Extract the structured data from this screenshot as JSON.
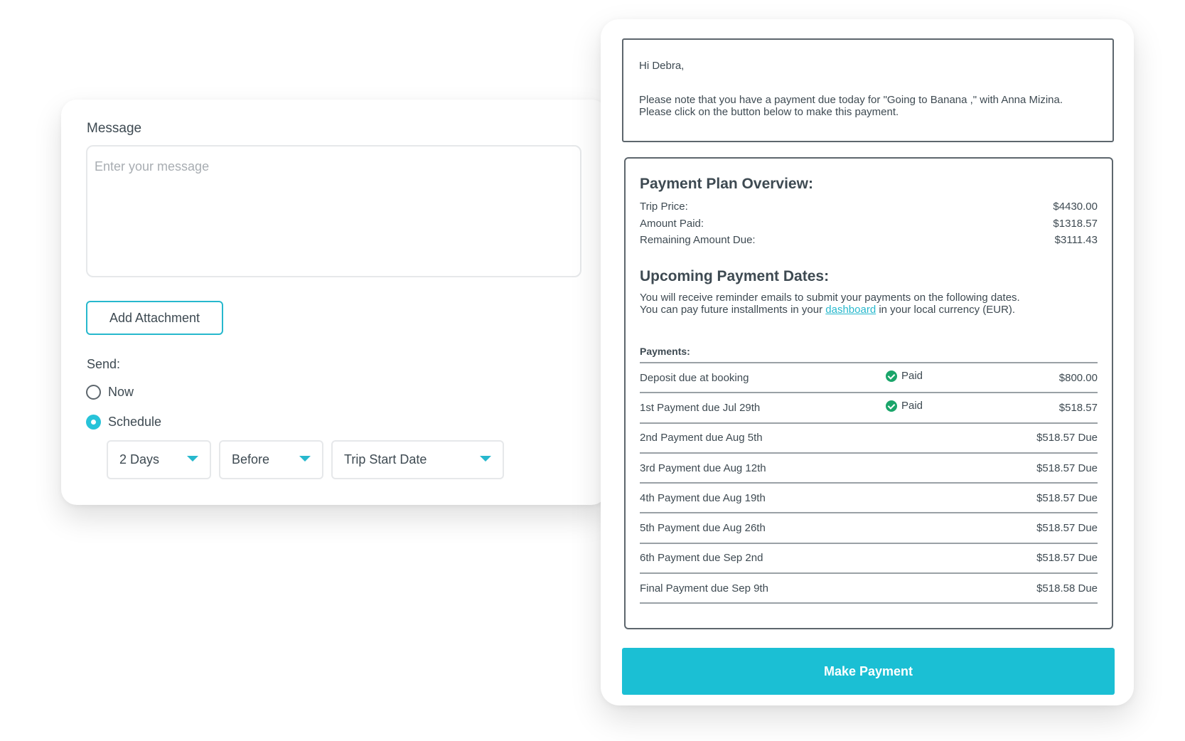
{
  "composer": {
    "message_label": "Message",
    "message_placeholder": "Enter your message",
    "add_attachment_label": "Add Attachment",
    "send_label": "Send:",
    "send_options": [
      {
        "label": "Now",
        "selected": false
      },
      {
        "label": "Schedule",
        "selected": true
      }
    ],
    "schedule": {
      "offset": "2 Days",
      "relation": "Before",
      "anchor": "Trip Start Date"
    }
  },
  "email": {
    "greeting": "Hi Debra,",
    "body": "Please note that you have a payment due today for \"Going to Banana ,\" with Anna Mizina. Please click on the button below to make this payment."
  },
  "overview": {
    "title": "Payment Plan Overview:",
    "rows": [
      {
        "label": "Trip Price:",
        "value": "$4430.00"
      },
      {
        "label": "Amount Paid:",
        "value": "$1318.57"
      },
      {
        "label": "Remaining Amount Due:",
        "value": "$3111.43"
      }
    ]
  },
  "upcoming": {
    "title": "Upcoming Payment Dates:",
    "line1": "You will receive reminder emails to submit your payments on the following dates.",
    "line2_before": "You can pay future installments in your ",
    "link_text": "dashboard",
    "line2_after": " in your local currency (EUR)."
  },
  "payments": {
    "label": "Payments:",
    "rows": [
      {
        "desc": "Deposit due at booking",
        "status": "Paid",
        "amount": "$800.00"
      },
      {
        "desc": "1st Payment due Jul 29th",
        "status": "Paid",
        "amount": "$518.57"
      },
      {
        "desc": "2nd Payment due Aug 5th",
        "status": "",
        "amount": "$518.57 Due"
      },
      {
        "desc": "3rd Payment due Aug 12th",
        "status": "",
        "amount": "$518.57 Due"
      },
      {
        "desc": "4th Payment due Aug 19th",
        "status": "",
        "amount": "$518.57 Due"
      },
      {
        "desc": "5th Payment due Aug 26th",
        "status": "",
        "amount": "$518.57 Due"
      },
      {
        "desc": "6th Payment due Sep 2nd",
        "status": "",
        "amount": "$518.57 Due"
      },
      {
        "desc": "Final Payment due Sep 9th",
        "status": "",
        "amount": "$518.58 Due"
      }
    ]
  },
  "make_payment_label": "Make Payment",
  "colors": {
    "accent": "#1bbfd4",
    "paid_check": "#1aa56a",
    "text": "#3e4a52"
  }
}
